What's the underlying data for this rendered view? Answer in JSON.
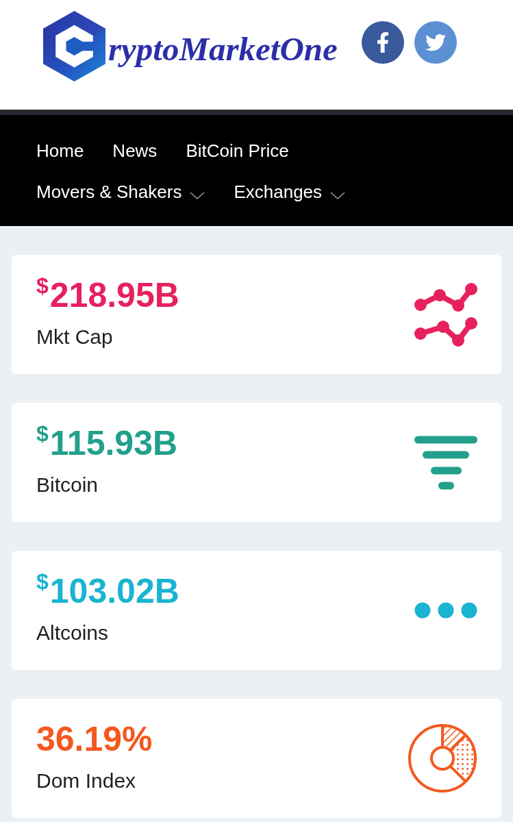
{
  "header": {
    "logo_text": "ryptoMarketOne",
    "social": [
      {
        "kind": "facebook"
      },
      {
        "kind": "twitter"
      }
    ]
  },
  "nav": {
    "items": [
      {
        "label": "Home",
        "has_dropdown": false
      },
      {
        "label": "News",
        "has_dropdown": false
      },
      {
        "label": "BitCoin Price",
        "has_dropdown": false
      },
      {
        "label": "Movers & Shakers",
        "has_dropdown": true
      },
      {
        "label": "Exchanges",
        "has_dropdown": true
      }
    ]
  },
  "stats": [
    {
      "kind": "trend",
      "currency": "$",
      "value": "218.95B",
      "label": "Mkt Cap",
      "color": "#e6215e"
    },
    {
      "kind": "funnel",
      "currency": "$",
      "value": "115.93B",
      "label": "Bitcoin",
      "color": "#22a08c"
    },
    {
      "kind": "dots",
      "currency": "$",
      "value": "103.02B",
      "label": "Altcoins",
      "color": "#19b4d2"
    },
    {
      "kind": "pie",
      "value": "36.19%",
      "label": "Dom Index",
      "color": "#f4581f"
    }
  ]
}
